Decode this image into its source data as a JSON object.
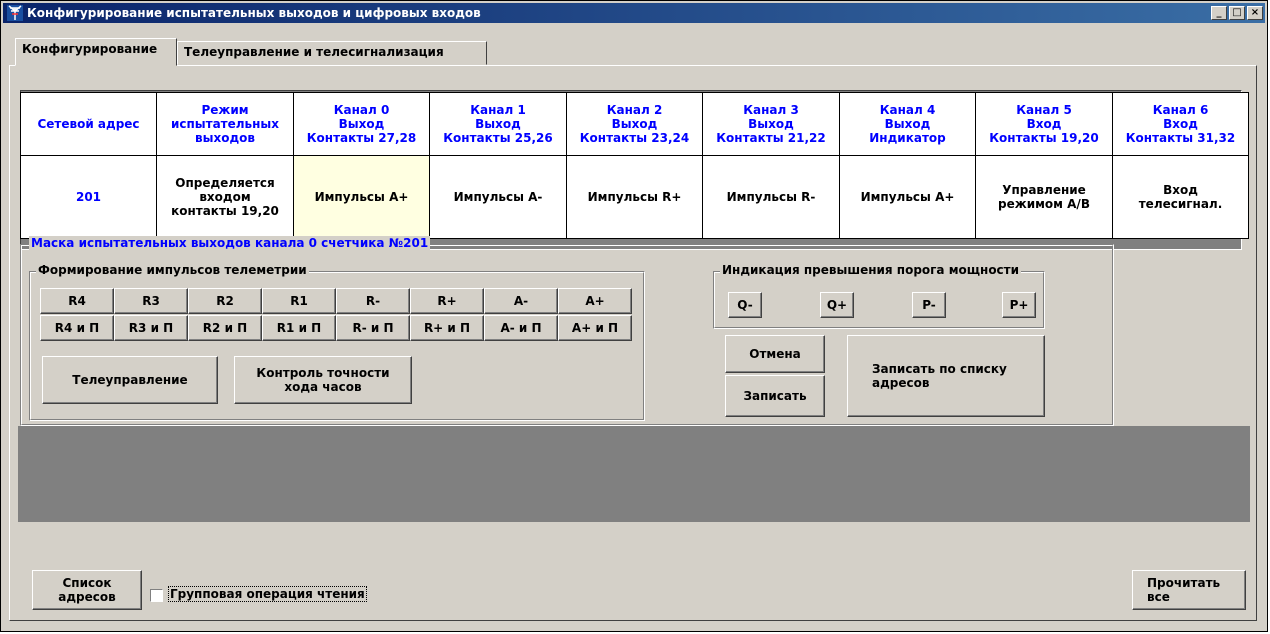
{
  "window": {
    "title": "Конфигурирование испытательных выходов и цифровых входов"
  },
  "tabs": [
    {
      "label": "Конфигурирование"
    },
    {
      "label": "Телеуправление и телесигнализация"
    }
  ],
  "table": {
    "headers": [
      {
        "l1": "Сетевой адрес",
        "l2": "",
        "l3": ""
      },
      {
        "l1": "Режим",
        "l2": "испытательных",
        "l3": "выходов"
      },
      {
        "l1": "Канал 0",
        "l2": "Выход",
        "l3": "Контакты 27,28"
      },
      {
        "l1": "Канал 1",
        "l2": "Выход",
        "l3": "Контакты 25,26"
      },
      {
        "l1": "Канал 2",
        "l2": "Выход",
        "l3": "Контакты 23,24"
      },
      {
        "l1": "Канал 3",
        "l2": "Выход",
        "l3": "Контакты 21,22"
      },
      {
        "l1": "Канал 4",
        "l2": "Выход",
        "l3": "Индикатор"
      },
      {
        "l1": "Канал 5",
        "l2": "Вход",
        "l3": "Контакты 19,20"
      },
      {
        "l1": "Канал 6",
        "l2": "Вход",
        "l3": "Контакты 31,32"
      }
    ],
    "values": [
      {
        "l1": "201",
        "l2": "",
        "l3": ""
      },
      {
        "l1": "Определяется",
        "l2": "входом",
        "l3": "контакты 19,20"
      },
      {
        "l1": "Импульсы А+",
        "l2": "",
        "l3": ""
      },
      {
        "l1": "Импульсы А-",
        "l2": "",
        "l3": ""
      },
      {
        "l1": "Импульсы R+",
        "l2": "",
        "l3": ""
      },
      {
        "l1": "Импульсы R-",
        "l2": "",
        "l3": ""
      },
      {
        "l1": "Импульсы А+",
        "l2": "",
        "l3": ""
      },
      {
        "l1": "Управление",
        "l2": "режимом А/В",
        "l3": ""
      },
      {
        "l1": "Вход",
        "l2": "телесигнал.",
        "l3": ""
      }
    ],
    "selected_column": 2
  },
  "mask_group": {
    "title": "Маска испытательных выходов канала 0 счетчика №201"
  },
  "telemetry_group": {
    "title": "Формирование импульсов телеметрии",
    "row1": [
      "R4",
      "R3",
      "R2",
      "R1",
      "R-",
      "R+",
      "A-",
      "A+"
    ],
    "row2": [
      "R4 и П",
      "R3 и П",
      "R2 и П",
      "R1 и П",
      "R- и П",
      "R+ и П",
      "A- и П",
      "A+ и П"
    ],
    "remote_control": "Телеуправление",
    "clock_check_l1": "Контроль точности",
    "clock_check_l2": "хода часов"
  },
  "power_group": {
    "title": "Индикация превышения порога мощности",
    "buttons": [
      "Q-",
      "Q+",
      "P-",
      "P+"
    ]
  },
  "actions": {
    "cancel": "Отмена",
    "write": "Записать",
    "write_list_l1": "Записать по списку",
    "write_list_l2": "адресов"
  },
  "footer": {
    "address_list_l1": "Список",
    "address_list_l2": "адресов",
    "group_read_label": "Групповая операция чтения",
    "group_read_checked": false,
    "read_all_l1": "Прочитать",
    "read_all_l2": "все"
  }
}
